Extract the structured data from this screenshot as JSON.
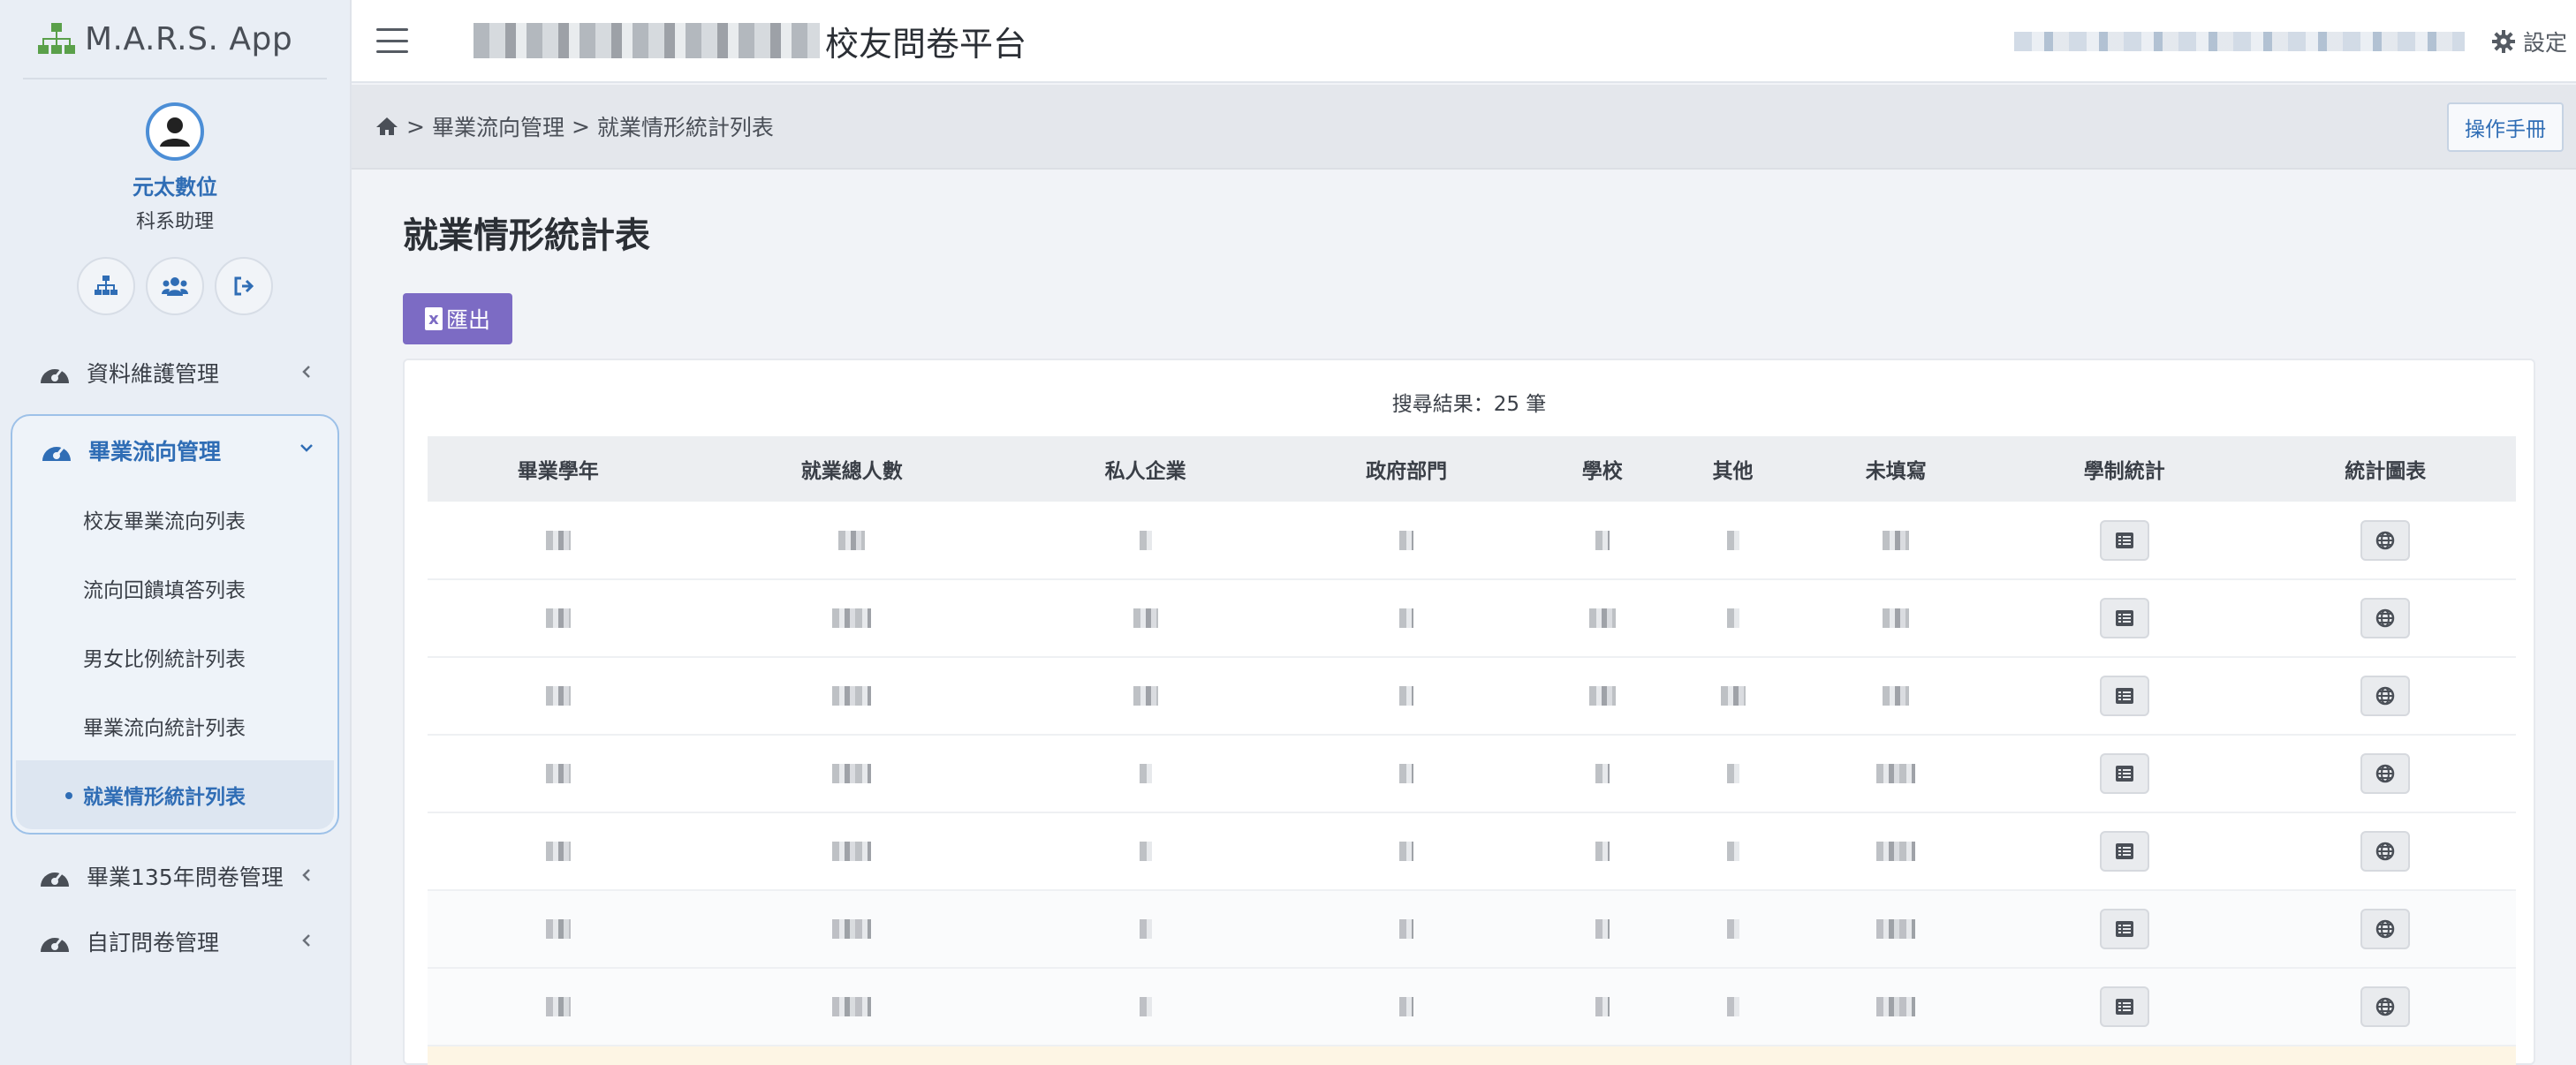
{
  "app": {
    "brand": "M.A.R.S. App"
  },
  "user": {
    "name": "元太數位",
    "role": "科系助理"
  },
  "sidebar": {
    "items": [
      {
        "label": "資料維護管理"
      },
      {
        "label": "畢業流向管理"
      },
      {
        "label": "畢業135年問卷管理"
      },
      {
        "label": "自訂問卷管理"
      }
    ],
    "subitems": [
      {
        "label": "校友畢業流向列表"
      },
      {
        "label": "流向回饋填答列表"
      },
      {
        "label": "男女比例統計列表"
      },
      {
        "label": "畢業流向統計列表"
      },
      {
        "label": "就業情形統計列表"
      }
    ]
  },
  "header": {
    "title_suffix": "校友問卷平台",
    "settings_label": "設定"
  },
  "breadcrumb": {
    "items": [
      "畢業流向管理",
      "就業情形統計列表"
    ],
    "separator": ">"
  },
  "manual_button": "操作手冊",
  "page": {
    "title": "就業情形統計表",
    "export_label": "匯出",
    "export_icon_glyph": "x"
  },
  "table": {
    "result_count": "搜尋結果：25 筆",
    "headers": [
      "畢業學年",
      "就業總人數",
      "私人企業",
      "政府部門",
      "學校",
      "其他",
      "未填寫",
      "學制統計",
      "統計圖表"
    ]
  },
  "icons": {
    "brand": "sitemap-icon",
    "avatar": "user-icon",
    "org": "sitemap-icon",
    "users": "users-icon",
    "logout": "logout-icon",
    "nav": "dashboard-gauge-icon",
    "home": "home-icon",
    "settings": "gear-icon",
    "list": "list-icon",
    "chart": "globe-icon"
  },
  "colors": {
    "accent": "#2f6db5",
    "export": "#7c6bc4",
    "sidebar_bg": "#e9eef5"
  }
}
